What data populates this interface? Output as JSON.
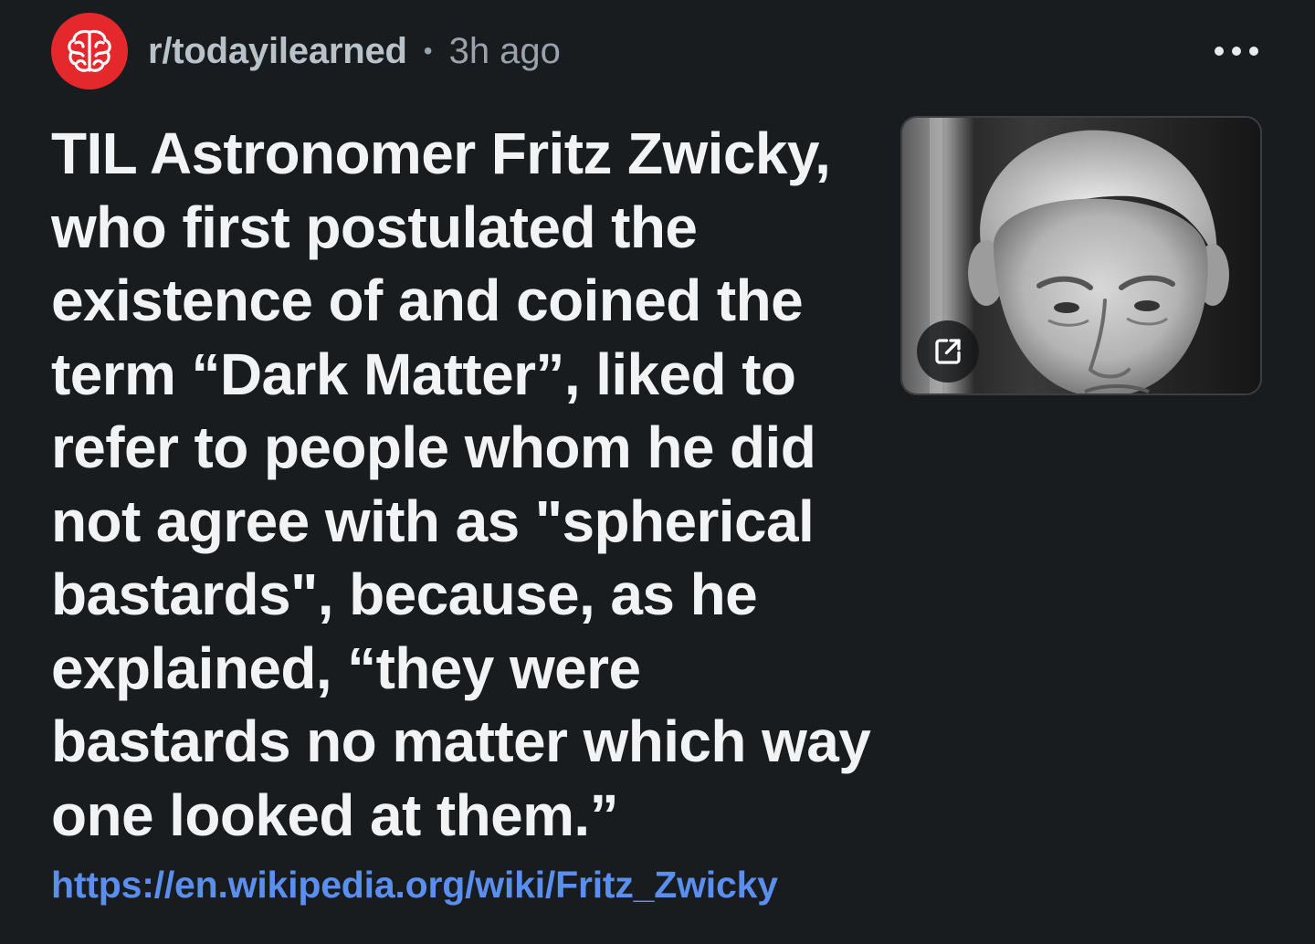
{
  "post": {
    "subreddit": "r/todayilearned",
    "separator": "•",
    "age": "3h ago",
    "title": "TIL Astronomer Fritz Zwicky, who first postulated the existence of and coined the term “Dark Matter”, liked to refer to people whom he did not agree with as \"spherical bastards\", because, as he explained, “they were bastards no matter which way one looked at them.”",
    "link": "https://en.wikipedia.org/wiki/Fritz_Zwicky"
  },
  "icons": {
    "subreddit_avatar": "brain-icon",
    "more": "more-options-icon",
    "external_link": "external-link-icon",
    "thumbnail": "portrait-photo"
  },
  "colors": {
    "background": "#191c1f",
    "avatar": "#e4282b",
    "link": "#5a8ff0",
    "title": "#f1f3f5",
    "meta": "#9aa3ad"
  }
}
